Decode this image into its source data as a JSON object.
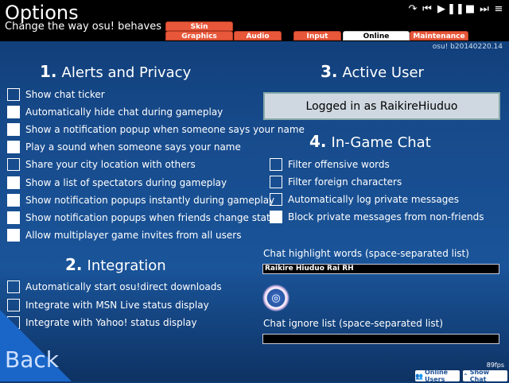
{
  "header": {
    "title": "Options",
    "subtitle": "Change the way osu! behaves"
  },
  "media_icons": [
    "redo-icon",
    "rewind-icon",
    "play-icon",
    "pause-icon",
    "stop-icon",
    "menu-icon"
  ],
  "tabs": {
    "skin": "Skin",
    "graphics": "Graphics",
    "audio": "Audio",
    "input": "Input",
    "online": "Online",
    "maintenance": "Maintenance",
    "active": "Online"
  },
  "version": "osu! b20140220.14",
  "alerts": {
    "number": "1.",
    "title": "Alerts and Privacy",
    "items": [
      {
        "label": "Show chat ticker",
        "checked": false
      },
      {
        "label": "Automatically hide chat during gameplay",
        "checked": true
      },
      {
        "label": "Show a notification popup when someone says your name",
        "checked": true
      },
      {
        "label": "Play a sound when someone says your name",
        "checked": true
      },
      {
        "label": "Share your city location with others",
        "checked": false
      },
      {
        "label": "Show a list of spectators during gameplay",
        "checked": true
      },
      {
        "label": "Show notification popups instantly during gameplay",
        "checked": true
      },
      {
        "label": "Show notification popups when friends change status",
        "checked": true
      },
      {
        "label": "Allow multiplayer game invites from all users",
        "checked": true
      }
    ]
  },
  "integration": {
    "number": "2.",
    "title": "Integration",
    "items": [
      {
        "label": "Automatically start osu!direct downloads",
        "checked": false
      },
      {
        "label": "Integrate with MSN Live status display",
        "checked": false
      },
      {
        "label": "Integrate with Yahoo! status display",
        "checked": false
      }
    ]
  },
  "active_user": {
    "number": "3.",
    "title": "Active User",
    "status": "Logged in as RaikireHiuduo"
  },
  "ingame_chat": {
    "number": "4.",
    "title": "In-Game Chat",
    "items": [
      {
        "label": "Filter offensive words",
        "checked": false
      },
      {
        "label": "Filter foreign characters",
        "checked": false
      },
      {
        "label": "Automatically log private messages",
        "checked": false
      },
      {
        "label": "Block private messages from non-friends",
        "checked": true
      }
    ],
    "highlight_label": "Chat highlight words (space-separated list)",
    "highlight_value": "Raikire Hiuduo Rai RH",
    "ignore_label": "Chat ignore list (space-separated list)",
    "ignore_value": ""
  },
  "footer": {
    "back": "Back",
    "fps": "89fps",
    "online_users": "Online Users",
    "show_chat": "Show Chat"
  },
  "colors": {
    "tab": "#e8573a",
    "background": "#174b8c"
  }
}
